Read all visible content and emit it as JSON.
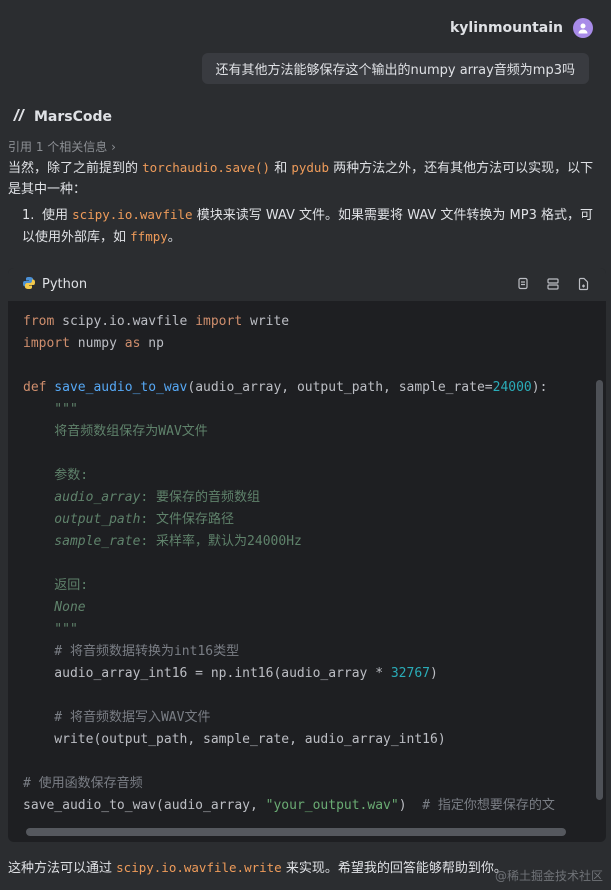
{
  "user": {
    "name": "kylinmountain",
    "message": "还有其他方法能够保存这个输出的numpy array音频为mp3吗"
  },
  "bot": {
    "name": "MarsCode",
    "reference": "引用 1 个相关信息 ›"
  },
  "answer": {
    "p1_a": "当然，除了之前提到的 ",
    "p1_code1": "torchaudio.save()",
    "p1_b": " 和 ",
    "p1_code2": "pydub",
    "p1_c": " 两种方法之外，还有其他方法可以实现，以下是其中一种：",
    "li1_num": "1.",
    "li1_a": "使用 ",
    "li1_code1": "scipy.io.wavfile",
    "li1_b": " 模块来读写 WAV 文件。如果需要将 WAV 文件转换为 MP3 格式，可以使用外部库，如 ",
    "li1_code2": "ffmpy",
    "li1_c": "。"
  },
  "code": {
    "language": "Python",
    "l1_kw1": "from",
    "l1_mod": " scipy.io.wavfile ",
    "l1_kw2": "import",
    "l1_name": " write",
    "l2_kw1": "import",
    "l2_mod": " numpy ",
    "l2_kw2": "as",
    "l2_name": " np",
    "l4_kw": "def",
    "l4_fn": " save_audio_to_wav",
    "l4_args": "(audio_array, output_path, sample_rate=",
    "l4_num": "24000",
    "l4_end": "):",
    "l5": "    \"\"\"",
    "l6": "    将音频数组保存为WAV文件",
    "l8": "    参数:",
    "l9_a": "    audio_array",
    "l9_b": ": 要保存的音频数组",
    "l10_a": "    output_path",
    "l10_b": ": 文件保存路径",
    "l11_a": "    sample_rate",
    "l11_b": ": 采样率，默认为24000Hz",
    "l13": "    返回:",
    "l14": "    None",
    "l15": "    \"\"\"",
    "l16": "    # 将音频数据转换为int16类型",
    "l17_a": "    audio_array_int16 = np.int16(audio_array * ",
    "l17_num": "32767",
    "l17_b": ")",
    "l19": "    # 将音频数据写入WAV文件",
    "l20": "    write(output_path, sample_rate, audio_array_int16)",
    "l22": "# 使用函数保存音频",
    "l23_a": "save_audio_to_wav(audio_array, ",
    "l23_str": "\"your_output.wav\"",
    "l23_b": ")  ",
    "l23_cm": "# 指定你想要保存的文"
  },
  "closing": {
    "a": "这种方法可以通过 ",
    "code": "scipy.io.wavfile.write",
    "b": " 来实现。希望我的回答能够帮助到你。"
  },
  "watermark": "@稀土掘金技术社区"
}
